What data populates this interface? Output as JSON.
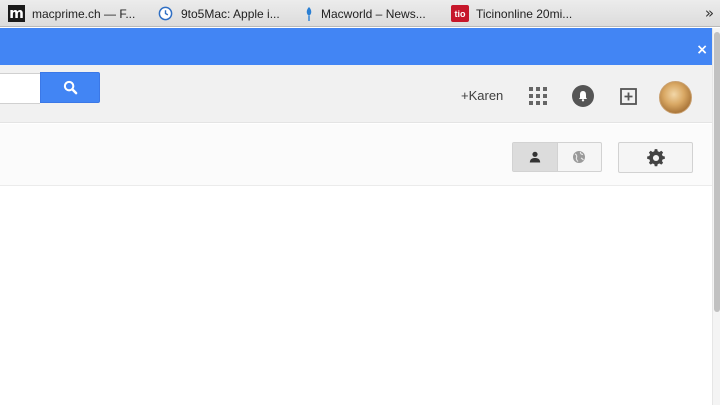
{
  "bookmarks": [
    {
      "label": "macprime.ch — F...",
      "icon": "macprime-m-icon",
      "glyph": "m"
    },
    {
      "label": "9to5Mac: Apple i...",
      "icon": "clock-icon"
    },
    {
      "label": "Macworld – News...",
      "icon": "macworld-pin-icon"
    },
    {
      "label": "Ticinonline 20mi...",
      "icon": "tio-icon",
      "glyph": "tio"
    }
  ],
  "bookmarks_overflow": "»",
  "banner": {
    "close_label": "×"
  },
  "header": {
    "user_link": "+Karen"
  },
  "colors": {
    "accent": "#4285f4",
    "ticino": "#c6172b"
  }
}
